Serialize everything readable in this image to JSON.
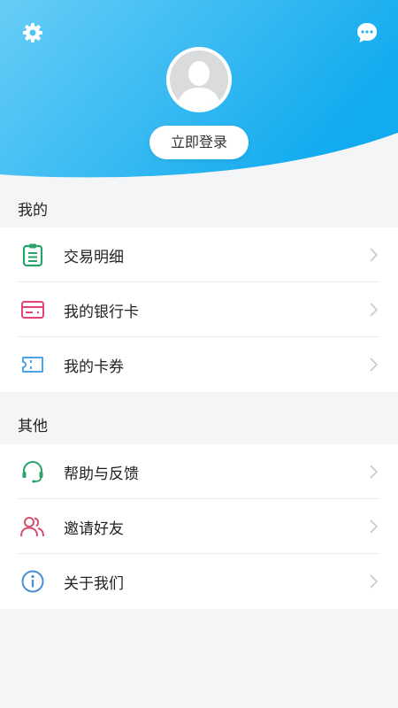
{
  "header": {
    "login_label": "立即登录"
  },
  "icons": {
    "settings": "gear-icon",
    "messages": "chat-bubble-icon",
    "avatar": "default-user-avatar"
  },
  "colors": {
    "header_gradient_start": "#5cc9f5",
    "header_gradient_end": "#17aef0",
    "page_background": "#f4f5f7",
    "transaction_icon": "#2aa36b",
    "bank_card_icon": "#e0447a",
    "coupon_icon": "#4aa6e8",
    "help_icon": "#2aa36b",
    "invite_icon": "#d4506c",
    "about_icon": "#4a8fd4"
  },
  "sections": {
    "mine": {
      "title": "我的",
      "items": [
        {
          "label": "交易明细",
          "icon": "receipt-icon"
        },
        {
          "label": "我的银行卡",
          "icon": "bank-card-icon"
        },
        {
          "label": "我的卡券",
          "icon": "coupon-icon"
        }
      ]
    },
    "other": {
      "title": "其他",
      "items": [
        {
          "label": "帮助与反馈",
          "icon": "headset-icon"
        },
        {
          "label": "邀请好友",
          "icon": "invite-users-icon"
        },
        {
          "label": "关于我们",
          "icon": "info-icon"
        }
      ]
    }
  }
}
